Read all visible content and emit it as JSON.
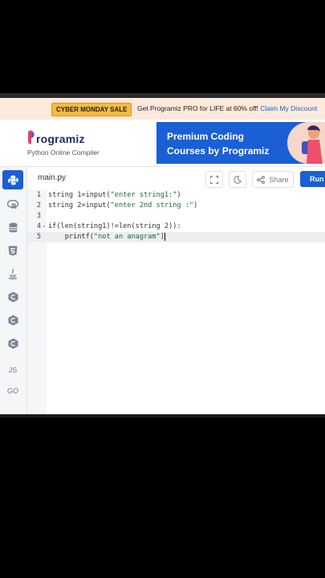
{
  "promo": {
    "badge": "CYBER MONDAY SALE",
    "message": "Get Programiz PRO for LIFE at 60% off!",
    "link": "Claim My Discount"
  },
  "header": {
    "logo": "rogramiz",
    "subtitle": "Python Online Compiler",
    "ad_line1": "Premium Coding",
    "ad_line2": "Courses by Programiz"
  },
  "toolbar": {
    "file_tab": "main.py",
    "share_label": "Share",
    "run_label": "Run"
  },
  "sidebar": {
    "items": [
      "python",
      "r",
      "sql",
      "html",
      "java",
      "c",
      "cpp",
      "csharp",
      "JS",
      "GO"
    ]
  },
  "editor": {
    "lines": [
      {
        "n": "1",
        "text": "string 1=input(\"enter string1:\")"
      },
      {
        "n": "2",
        "text": "string 2=input(\"enter 2nd string :\")"
      },
      {
        "n": "3",
        "text": ""
      },
      {
        "n": "4",
        "text": "if(len(string1)!=len(string 2)):"
      },
      {
        "n": "5",
        "text": "    printf(\"not an anagram\")"
      }
    ]
  },
  "colors": {
    "brand_blue": "#1a5fd6",
    "promo_bg": "#fbe9dc",
    "badge_bg": "#f4b942",
    "string_green": "#1c6b2f"
  }
}
